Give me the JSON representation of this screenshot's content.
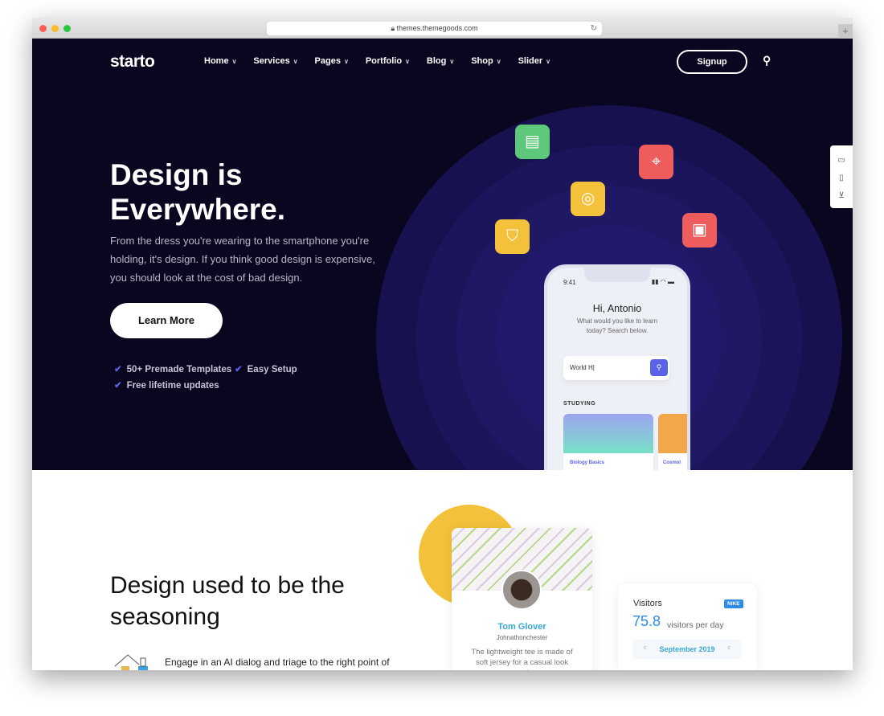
{
  "browser": {
    "url": "themes.themegoods.com"
  },
  "nav": {
    "logo": "starto",
    "items": [
      {
        "label": "Home"
      },
      {
        "label": "Services"
      },
      {
        "label": "Pages"
      },
      {
        "label": "Portfolio"
      },
      {
        "label": "Blog"
      },
      {
        "label": "Shop"
      },
      {
        "label": "Slider"
      }
    ],
    "signup": "Signup"
  },
  "hero": {
    "title_line1": "Design is",
    "title_line2": "Everywhere.",
    "subtitle": "From the dress you're wearing to the smartphone you're holding, it's design. If you think good design is expensive, you should look at the cost of bad design.",
    "cta": "Learn More",
    "features": [
      "50+ Premade Templates",
      "Easy Setup",
      "Free lifetime updates"
    ]
  },
  "phone": {
    "time": "9:41",
    "greeting": "Hi, Antonio",
    "prompt": "What would you like to learn today? Search below.",
    "search_value": "World H|",
    "section": "STUDYING",
    "courses": [
      "Biology Basics",
      "Cosmol"
    ]
  },
  "section2": {
    "title": "Design used to be the seasoning",
    "text": "Engage in an AI dialog and triage to the right point of"
  },
  "profile": {
    "name": "Tom Glover",
    "handle": "Johnathonchester",
    "bio": "The lightweight tee is made of soft jersey for a casual look and"
  },
  "visitors": {
    "title": "Visitors",
    "badge": "NIKE",
    "value": "75.8",
    "unit": "visitors per day",
    "month": "September 2019",
    "prev": "c",
    "next": "c"
  },
  "colors": {
    "hero_bg": "#0a0620",
    "accent": "#5b62e8",
    "yellow": "#f3c13a",
    "blue": "#2d8ce8"
  }
}
